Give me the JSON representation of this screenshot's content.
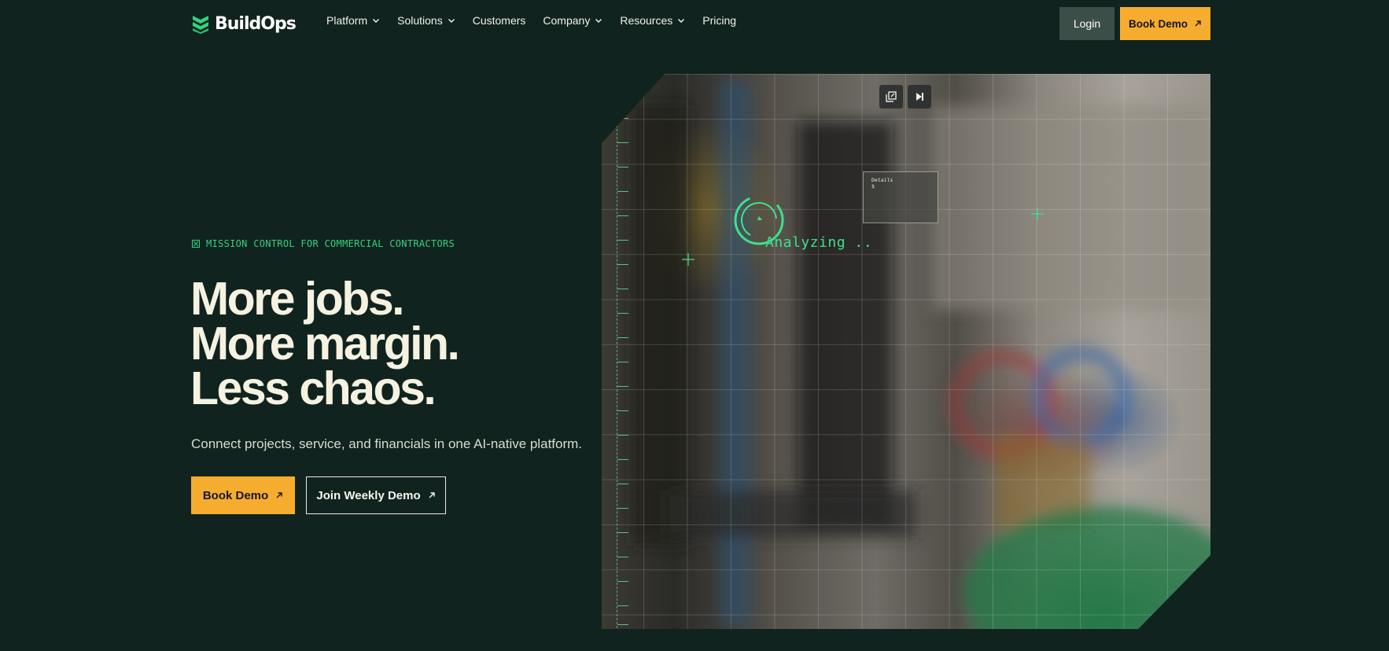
{
  "brand": {
    "name": "BuildOps",
    "accent_color": "#2fd47f",
    "cta_color": "#f6ad2f",
    "background_color": "#11231e"
  },
  "nav": {
    "items": [
      {
        "label": "Platform",
        "has_dropdown": true
      },
      {
        "label": "Solutions",
        "has_dropdown": true
      },
      {
        "label": "Customers",
        "has_dropdown": false
      },
      {
        "label": "Company",
        "has_dropdown": true
      },
      {
        "label": "Resources",
        "has_dropdown": true
      },
      {
        "label": "Pricing",
        "has_dropdown": false
      }
    ],
    "login_label": "Login",
    "book_demo_label": "Book Demo"
  },
  "hero": {
    "eyebrow": "MISSION CONTROL FOR COMMERCIAL CONTRACTORS",
    "headline": [
      "More jobs.",
      "More margin.",
      "Less chaos."
    ],
    "subhead": "Connect projects, service, and financials in one AI-native platform.",
    "primary_cta": "Book Demo",
    "secondary_cta": "Join Weekly Demo"
  },
  "visual": {
    "status_text": "Analyzing ..",
    "details_title": "Details",
    "details_value": "$",
    "controls": {
      "popout_icon": "popout-icon",
      "skip_icon": "skip-forward-icon"
    }
  }
}
